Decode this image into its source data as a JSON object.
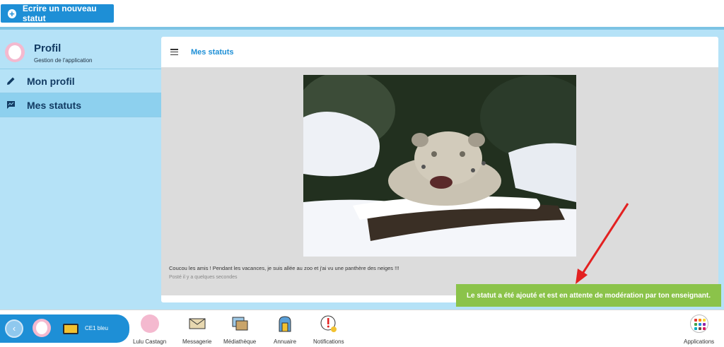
{
  "header": {
    "new_status_label": "Ecrire un nouveau statut"
  },
  "sidebar": {
    "profile_title": "Profil",
    "profile_subtitle": "Gestion de l'application",
    "items": [
      {
        "label": "Mon profil",
        "icon": "pencil-icon"
      },
      {
        "label": "Mes statuts",
        "icon": "status-icon"
      }
    ]
  },
  "main": {
    "title": "Mes statuts",
    "status": {
      "text": "Coucou les amis ! Pendant les vacances, je suis allée au zoo et j'ai vu une panthère des neiges !!!",
      "time": "Posté il y a quelques secondes"
    }
  },
  "toast": {
    "message": "Le statut a été ajouté et est en attente de modération par ton enseignant."
  },
  "dock": {
    "class_name": "CE1 bleu",
    "items": [
      {
        "label": "Lulu Castagn",
        "icon": "user-avatar-icon"
      },
      {
        "label": "Messagerie",
        "icon": "envelope-icon"
      },
      {
        "label": "Médiathèque",
        "icon": "media-icon"
      },
      {
        "label": "Annuaire",
        "icon": "directory-icon"
      },
      {
        "label": "Notifications",
        "icon": "notification-icon"
      }
    ],
    "apps_label": "Applications"
  },
  "colors": {
    "primary": "#1e8fd6",
    "toast": "#8bc34a",
    "sidebar_bg": "#b5e2f7",
    "arrow": "#e32121"
  }
}
